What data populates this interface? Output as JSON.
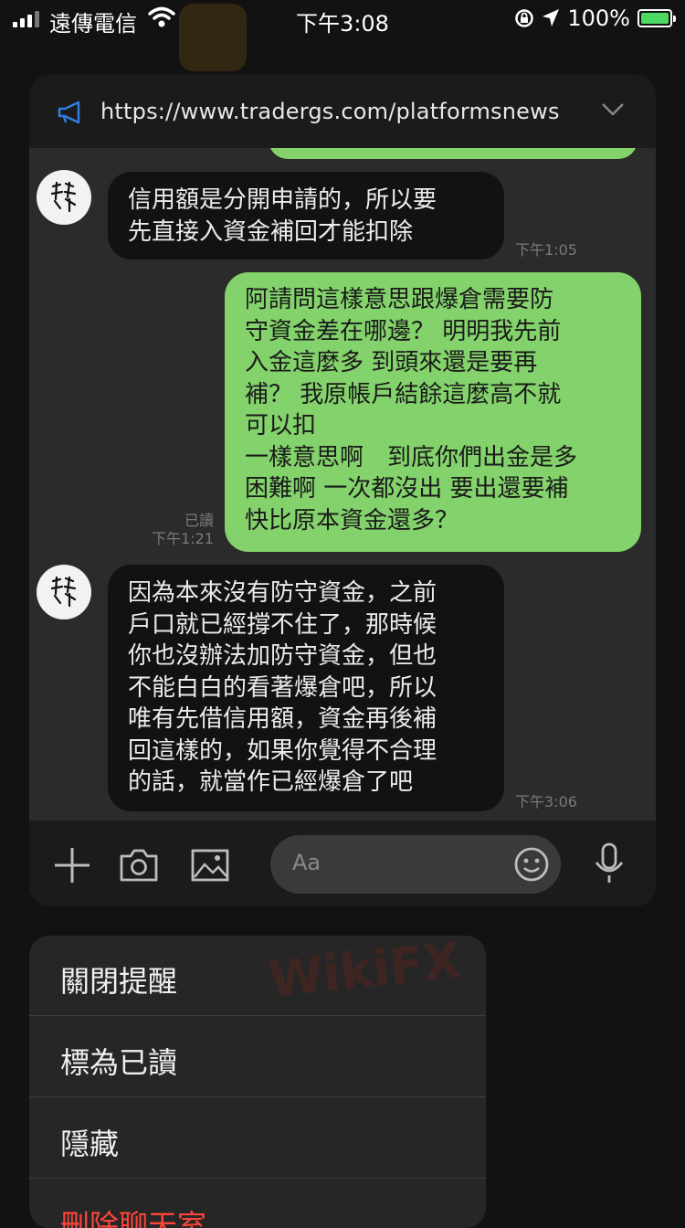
{
  "status_bar": {
    "carrier": "遠傳電信",
    "time": "下午3:08",
    "battery": "100%"
  },
  "link_bar": {
    "url": "https://www.tradergs.com/platformsnews"
  },
  "messages": [
    {
      "text": "信用額是分開申請的，所以要\n先直接入資金補回才能扣除",
      "time": "下午1:05"
    },
    {
      "text": "阿請問這樣意思跟爆倉需要防\n守資金差在哪邊？ 明明我先前\n入金這麼多 到頭來還是要再\n補？ 我原帳戶結餘這麼高不就\n可以扣\n一樣意思啊　到底你們出金是多\n困難啊 一次都沒出 要出還要補\n快比原本資金還多？",
      "read": "已讀",
      "time": "下午1:21"
    },
    {
      "text": "因為本來沒有防守資金，之前\n戶口就已經撐不住了，那時候\n你也沒辦法加防守資金，但也\n不能白白的看著爆倉吧，所以\n唯有先借信用額，資金再後補\n回這樣的，如果你覺得不合理\n的話，就當作已經爆倉了吧",
      "time": "下午3:06"
    }
  ],
  "input_bar": {
    "placeholder": "Aa"
  },
  "menu": {
    "items": [
      {
        "label": "關閉提醒"
      },
      {
        "label": "標為已讀"
      },
      {
        "label": "隱藏"
      },
      {
        "label": "刪除聊天室"
      }
    ]
  },
  "watermark_text": "WikiFX",
  "colors": {
    "outgoing_bubble": "#83d26b",
    "incoming_bubble": "#121212",
    "danger": "#ff453a"
  }
}
